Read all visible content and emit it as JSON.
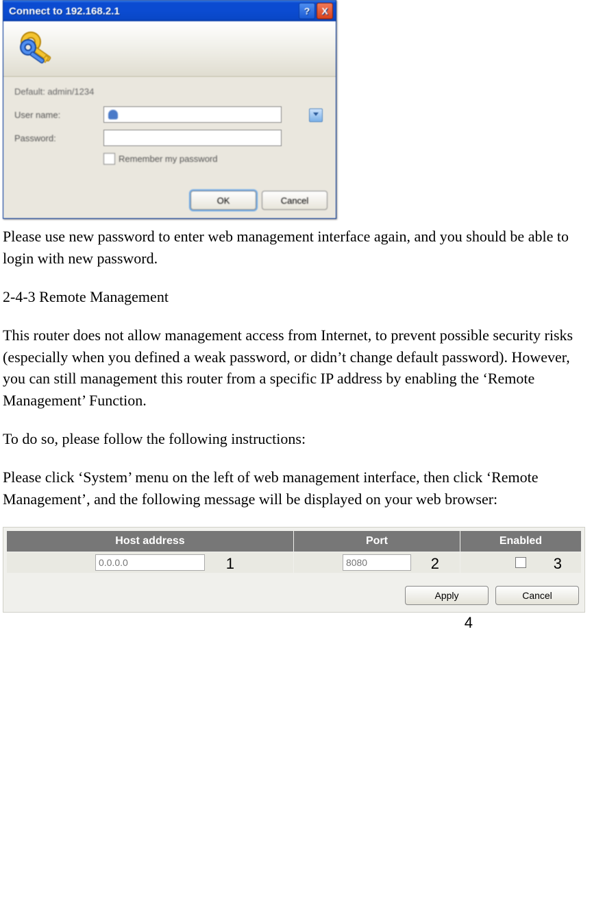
{
  "dialog": {
    "title": "Connect to 192.168.2.1",
    "default_line": "Default: admin/1234",
    "username_label": "User name:",
    "password_label": "Password:",
    "remember_label": "Remember my password",
    "ok_label": "OK",
    "cancel_label": "Cancel",
    "help_glyph": "?",
    "close_glyph": "X"
  },
  "body": {
    "p1": "Please use new password to enter web management interface again, and you should be able to login with new password.",
    "section_title": "2-4-3 Remote Management",
    "p2": "This router does not allow management access from Internet, to prevent possible security risks (especially when you defined a weak password, or didn’t change default password). However, you can still management this router from a specific IP address by enabling the ‘Remote Management’ Function.",
    "p3": "To do so, please follow the following instructions:",
    "p4": "Please click ‘System’ menu on the left of web management interface, then click ‘Remote Management’, and the following message will be displayed on your web browser:"
  },
  "rm": {
    "headers": {
      "host": "Host address",
      "port": "Port",
      "enabled": "Enabled"
    },
    "row": {
      "host_placeholder": "0.0.0.0",
      "port_placeholder": "8080"
    },
    "buttons": {
      "apply": "Apply",
      "cancel": "Cancel"
    },
    "callouts": {
      "c1": "1",
      "c2": "2",
      "c3": "3",
      "c4": "4"
    }
  }
}
